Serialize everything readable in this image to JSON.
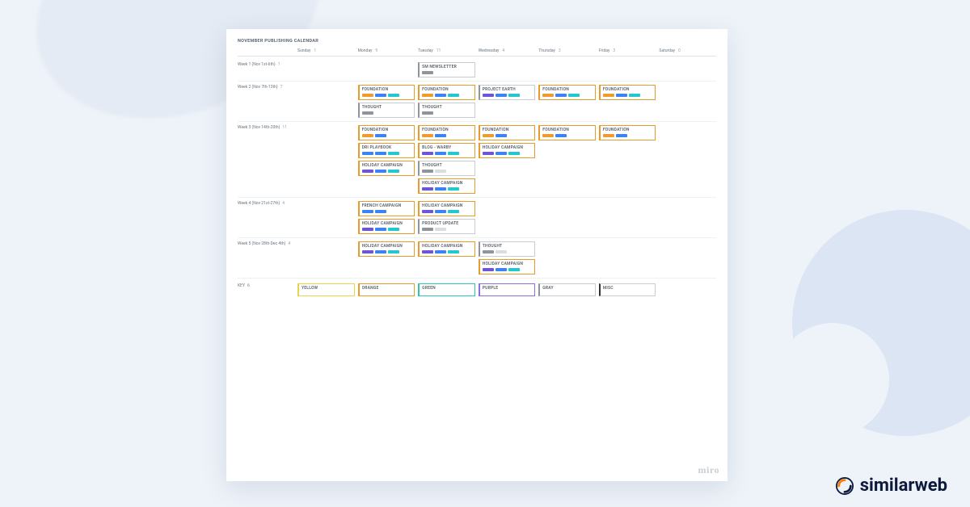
{
  "brand": {
    "name": "similarweb"
  },
  "miro_watermark": "miro",
  "calendar": {
    "title": "NOVEMBER PUBLISHING CALENDAR",
    "days": [
      {
        "name": "Sunday",
        "num": "1"
      },
      {
        "name": "Monday",
        "num": "9"
      },
      {
        "name": "Tuesday",
        "num": "11"
      },
      {
        "name": "Wednesday",
        "num": "4"
      },
      {
        "name": "Thursday",
        "num": "3"
      },
      {
        "name": "Friday",
        "num": "3"
      },
      {
        "name": "Saturday",
        "num": "0"
      }
    ],
    "weeks": [
      {
        "label": "Week 1 (Nov 1st-6th)",
        "count": "1",
        "cells": [
          [],
          [],
          [
            {
              "title": "SM NEWSLETTER",
              "color": "gray",
              "tags": [
                "gray"
              ]
            }
          ],
          [],
          [],
          [],
          []
        ]
      },
      {
        "label": "Week 2 (Nov 7th-13th)",
        "count": "7",
        "cells": [
          [],
          [
            {
              "title": "FOUNDATION",
              "color": "orange",
              "tags": [
                "orange",
                "blue",
                "teal"
              ]
            },
            {
              "title": "THOUGHT",
              "color": "gray",
              "tags": [
                "gray"
              ]
            }
          ],
          [
            {
              "title": "FOUNDATION",
              "color": "orange",
              "tags": [
                "orange",
                "blue",
                "teal"
              ]
            },
            {
              "title": "THOUGHT",
              "color": "gray",
              "tags": [
                "gray"
              ]
            }
          ],
          [
            {
              "title": "PROJECT EARTH",
              "color": "gray",
              "tags": [
                "purple",
                "blue",
                "teal"
              ]
            }
          ],
          [
            {
              "title": "FOUNDATION",
              "color": "orange",
              "tags": [
                "orange",
                "blue",
                "teal"
              ]
            }
          ],
          [
            {
              "title": "FOUNDATION",
              "color": "orange",
              "tags": [
                "orange",
                "blue",
                "teal"
              ]
            }
          ],
          []
        ]
      },
      {
        "label": "Week 3 (Nov 14th-20th)",
        "count": "11",
        "cells": [
          [],
          [
            {
              "title": "FOUNDATION",
              "color": "orange",
              "tags": [
                "orange",
                "blue"
              ]
            },
            {
              "title": "DRI PLAYBOOK",
              "color": "orange",
              "tags": [
                "blue",
                "blue",
                "teal"
              ]
            },
            {
              "title": "HOLIDAY CAMPAIGN",
              "color": "orange",
              "tags": [
                "purple",
                "blue",
                "teal"
              ]
            }
          ],
          [
            {
              "title": "FOUNDATION",
              "color": "orange",
              "tags": [
                "orange",
                "blue"
              ]
            },
            {
              "title": "BLOG - WARBY",
              "color": "orange",
              "tags": [
                "purple",
                "blue",
                "teal"
              ]
            },
            {
              "title": "THOUGHT",
              "color": "gray",
              "tags": [
                "gray",
                "light"
              ]
            },
            {
              "title": "HOLIDAY CAMPAIGN",
              "color": "orange",
              "tags": [
                "purple",
                "blue",
                "teal"
              ]
            }
          ],
          [
            {
              "title": "FOUNDATION",
              "color": "orange",
              "tags": [
                "orange",
                "blue"
              ]
            },
            {
              "title": "HOLIDAY CAMPAIGN",
              "color": "orange",
              "tags": [
                "purple",
                "blue",
                "teal"
              ]
            }
          ],
          [
            {
              "title": "FOUNDATION",
              "color": "orange",
              "tags": [
                "orange",
                "blue"
              ]
            }
          ],
          [
            {
              "title": "FOUNDATION",
              "color": "orange",
              "tags": [
                "orange",
                "blue"
              ]
            }
          ],
          []
        ]
      },
      {
        "label": "Week 4 (Nov 21st-27th)",
        "count": "4",
        "cells": [
          [],
          [
            {
              "title": "FRENCH CAMPAIGN",
              "color": "orange",
              "tags": [
                "blue",
                "blue"
              ]
            },
            {
              "title": "HOLIDAY CAMPAIGN",
              "color": "orange",
              "tags": [
                "purple",
                "blue",
                "teal"
              ]
            }
          ],
          [
            {
              "title": "HOLIDAY CAMPAIGN",
              "color": "orange",
              "tags": [
                "purple",
                "blue",
                "teal"
              ]
            },
            {
              "title": "PRODUCT UPDATE",
              "color": "gray",
              "tags": [
                "gray",
                "light"
              ]
            }
          ],
          [],
          [],
          [],
          []
        ]
      },
      {
        "label": "Week 5 (Nov 28th-Dec 4th)",
        "count": "4",
        "cells": [
          [],
          [
            {
              "title": "HOLIDAY CAMPAIGN",
              "color": "orange",
              "tags": [
                "purple",
                "blue",
                "teal"
              ]
            }
          ],
          [
            {
              "title": "HOLIDAY CAMPAIGN",
              "color": "orange",
              "tags": [
                "purple",
                "blue",
                "teal"
              ]
            }
          ],
          [
            {
              "title": "THOUGHT",
              "color": "gray",
              "tags": [
                "gray",
                "light"
              ]
            },
            {
              "title": "HOLIDAY CAMPAIGN",
              "color": "orange",
              "tags": [
                "purple",
                "blue",
                "teal"
              ]
            }
          ],
          [],
          [],
          []
        ]
      }
    ],
    "key": {
      "label": "KEY",
      "count": "6",
      "items": [
        {
          "title": "YELLOW",
          "color": "yellow"
        },
        {
          "title": "ORANGE",
          "color": "orange"
        },
        {
          "title": "GREEN",
          "color": "green"
        },
        {
          "title": "PURPLE",
          "color": "purple"
        },
        {
          "title": "GRAY",
          "color": "gray"
        },
        {
          "title": "MISC",
          "color": "black"
        }
      ]
    }
  }
}
